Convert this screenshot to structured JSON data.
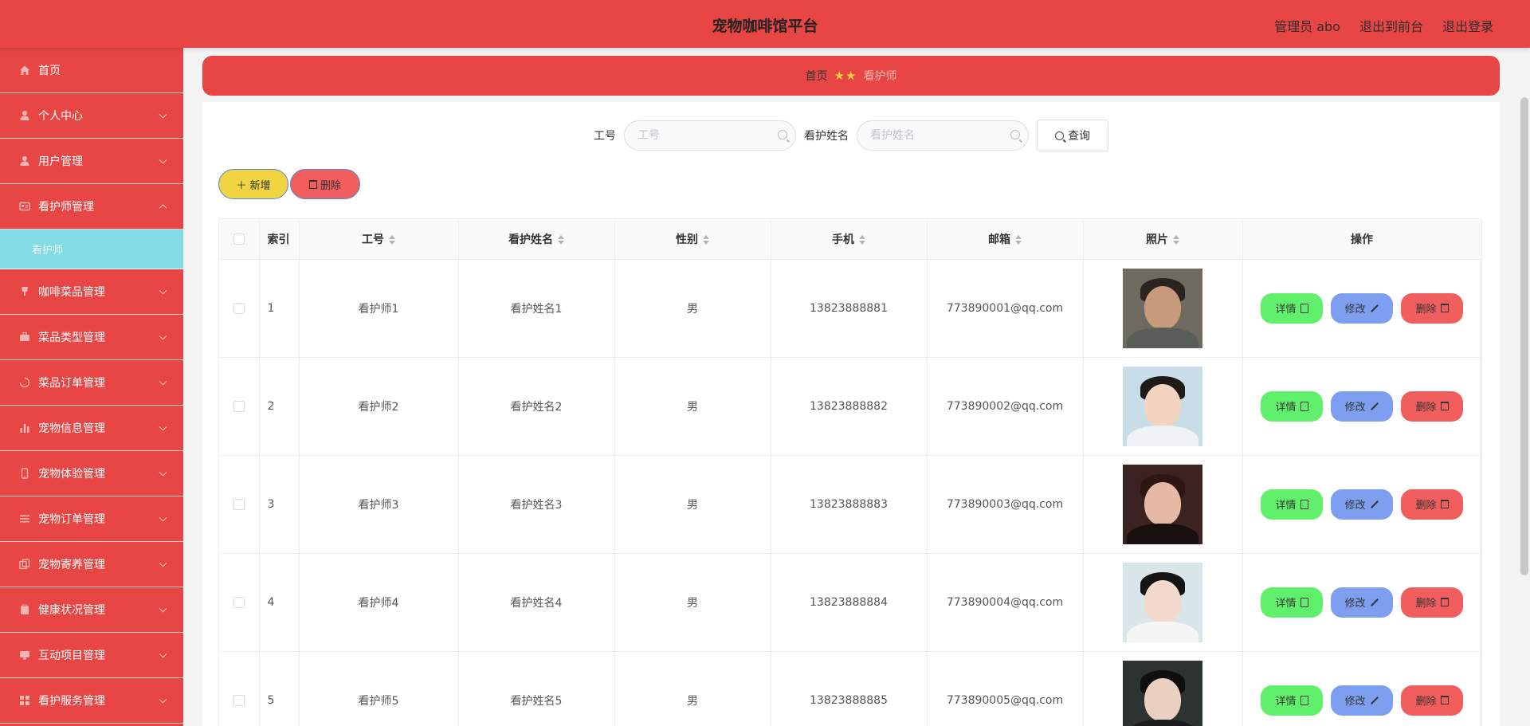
{
  "header": {
    "title": "宠物咖啡馆平台",
    "admin_label": "管理员 abo",
    "to_front_label": "退出到前台",
    "logout_label": "退出登录"
  },
  "sidebar": {
    "items": [
      {
        "label": "首页",
        "icon": "home-icon",
        "expandable": false
      },
      {
        "label": "个人中心",
        "icon": "user-icon",
        "expandable": true
      },
      {
        "label": "用户管理",
        "icon": "user-icon",
        "expandable": true
      },
      {
        "label": "看护师管理",
        "icon": "card-icon",
        "expandable": true,
        "expanded": true
      },
      {
        "label": "咖啡菜品管理",
        "icon": "cup-icon",
        "expandable": true
      },
      {
        "label": "菜品类型管理",
        "icon": "briefcase-icon",
        "expandable": true
      },
      {
        "label": "菜品订单管理",
        "icon": "loading-icon",
        "expandable": true
      },
      {
        "label": "宠物信息管理",
        "icon": "bar-chart-icon",
        "expandable": true
      },
      {
        "label": "宠物体验管理",
        "icon": "phone-icon",
        "expandable": true
      },
      {
        "label": "宠物订单管理",
        "icon": "list-icon",
        "expandable": true
      },
      {
        "label": "宠物寄养管理",
        "icon": "copy-icon",
        "expandable": true
      },
      {
        "label": "健康状况管理",
        "icon": "clipboard-icon",
        "expandable": true
      },
      {
        "label": "互动项目管理",
        "icon": "monitor-icon",
        "expandable": true
      },
      {
        "label": "看护服务管理",
        "icon": "grid-icon",
        "expandable": true
      }
    ],
    "sub_item": "看护师"
  },
  "breadcrumb": {
    "home": "首页",
    "stars": "★★",
    "current": "看护师"
  },
  "search": {
    "job_no_label": "工号",
    "job_no_placeholder": "工号",
    "name_label": "看护姓名",
    "name_placeholder": "看护姓名",
    "query_label": "查询"
  },
  "actions": {
    "add_label": "新增",
    "delete_label": "删除"
  },
  "table": {
    "headers": {
      "index": "索引",
      "job_no": "工号",
      "name": "看护姓名",
      "gender": "性别",
      "phone": "手机",
      "email": "邮箱",
      "photo": "照片",
      "ops": "操作"
    },
    "rows": [
      {
        "index": "1",
        "job_no": "看护师1",
        "name": "看护姓名1",
        "gender": "男",
        "phone": "13823888881",
        "email": "773890001@qq.com"
      },
      {
        "index": "2",
        "job_no": "看护师2",
        "name": "看护姓名2",
        "gender": "男",
        "phone": "13823888882",
        "email": "773890002@qq.com"
      },
      {
        "index": "3",
        "job_no": "看护师3",
        "name": "看护姓名3",
        "gender": "男",
        "phone": "13823888883",
        "email": "773890003@qq.com"
      },
      {
        "index": "4",
        "job_no": "看护师4",
        "name": "看护姓名4",
        "gender": "男",
        "phone": "13823888884",
        "email": "773890004@qq.com"
      },
      {
        "index": "5",
        "job_no": "看护师5",
        "name": "看护姓名5",
        "gender": "男",
        "phone": "13823888885",
        "email": "773890005@qq.com"
      }
    ],
    "op_labels": {
      "detail": "详情",
      "edit": "修改",
      "delete": "删除"
    }
  },
  "colors": {
    "primary_red": "#e84644",
    "active_sub": "#83dbe8",
    "add_yellow": "#f0d441",
    "detail_green": "#61f06b",
    "edit_blue": "#7e9ff0",
    "delete_red": "#f15e5e"
  }
}
